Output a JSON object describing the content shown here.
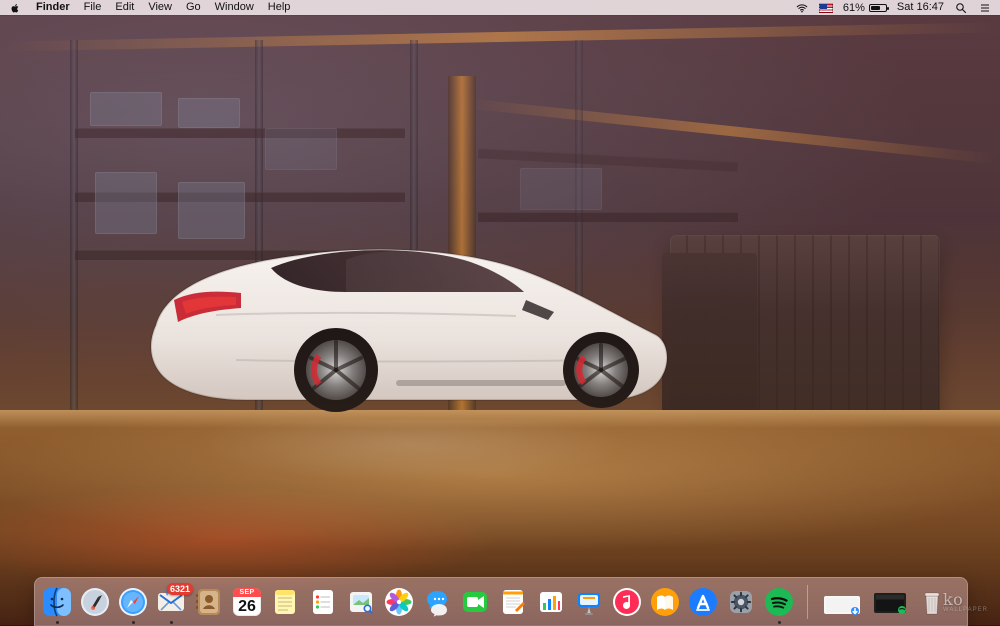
{
  "menubar": {
    "app_name": "Finder",
    "menus": [
      "File",
      "Edit",
      "View",
      "Go",
      "Window",
      "Help"
    ],
    "status": {
      "battery_percent_label": "61%",
      "battery_level": 0.61,
      "time_label": "Sat 16:47"
    }
  },
  "dock": {
    "apps": [
      {
        "name": "Finder",
        "icon": "finder-icon",
        "running": true
      },
      {
        "name": "Launchpad",
        "icon": "launchpad-icon",
        "running": false
      },
      {
        "name": "Safari",
        "icon": "safari-icon",
        "running": true
      },
      {
        "name": "Mail",
        "icon": "mail-icon",
        "running": true,
        "badge": "6321"
      },
      {
        "name": "Contacts",
        "icon": "contacts-icon",
        "running": false
      },
      {
        "name": "Calendar",
        "icon": "calendar-icon",
        "running": false,
        "calendar_month": "SEP",
        "calendar_day": "26"
      },
      {
        "name": "Notes",
        "icon": "notes-icon",
        "running": false
      },
      {
        "name": "Reminders",
        "icon": "reminders-icon",
        "running": false
      },
      {
        "name": "Preview",
        "icon": "preview-icon",
        "running": false
      },
      {
        "name": "Photos",
        "icon": "photos-icon",
        "running": false
      },
      {
        "name": "Messages",
        "icon": "messages-icon",
        "running": false
      },
      {
        "name": "FaceTime",
        "icon": "facetime-icon",
        "running": false
      },
      {
        "name": "Pages",
        "icon": "pages-icon",
        "running": false
      },
      {
        "name": "Numbers",
        "icon": "numbers-icon",
        "running": false
      },
      {
        "name": "Keynote",
        "icon": "keynote-icon",
        "running": false
      },
      {
        "name": "iTunes",
        "icon": "itunes-icon",
        "running": false
      },
      {
        "name": "iBooks",
        "icon": "ibooks-icon",
        "running": false
      },
      {
        "name": "App Store",
        "icon": "app-store-icon",
        "running": false
      },
      {
        "name": "System Preferences",
        "icon": "system-preferences-icon",
        "running": false
      },
      {
        "name": "Spotify",
        "icon": "spotify-icon",
        "running": true
      }
    ],
    "right_items": [
      {
        "name": "Downloads",
        "icon": "downloads-stack-icon"
      },
      {
        "name": "Minimized Window",
        "icon": "minimized-window-icon"
      },
      {
        "name": "Trash",
        "icon": "trash-icon"
      }
    ]
  },
  "watermark": {
    "text": "ko",
    "subtext": "WALLPAPER"
  }
}
